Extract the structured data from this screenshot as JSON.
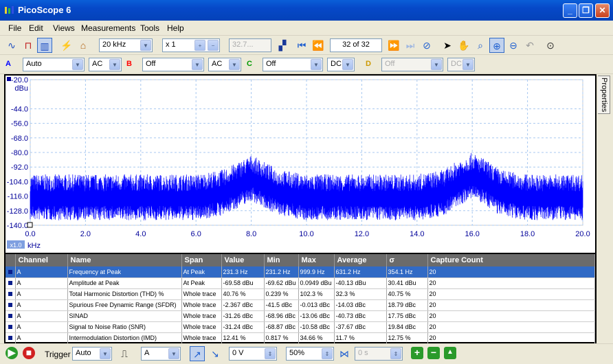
{
  "window": {
    "title": "PicoScope 6"
  },
  "menu": [
    "File",
    "Edit",
    "Views",
    "Measurements",
    "Tools",
    "Help"
  ],
  "toolbar": {
    "timebase": "20 kHz",
    "multiplier": "x 1",
    "disabled_value": "32.7...",
    "capture_counter": "32 of 32"
  },
  "channels": [
    {
      "label": "A",
      "range": "Auto",
      "coupling": "AC",
      "color": "#0000ff"
    },
    {
      "label": "B",
      "range": "Off",
      "coupling": "AC",
      "color": "#ff0000"
    },
    {
      "label": "C",
      "range": "Off",
      "coupling": "DC",
      "color": "#009900"
    },
    {
      "label": "D",
      "range": "Off",
      "coupling": "DC",
      "color": "#cc9900"
    }
  ],
  "plot": {
    "y_unit": "dBu",
    "y_ticks": [
      "-20.0",
      "-44.0",
      "-56.0",
      "-68.0",
      "-80.0",
      "-92.0",
      "-104.0",
      "-116.0",
      "-128.0",
      "-140.0"
    ],
    "x_ticks": [
      "0.0",
      "2.0",
      "4.0",
      "6.0",
      "8.0",
      "10.0",
      "12.0",
      "14.0",
      "16.0",
      "18.0",
      "20.0"
    ],
    "x_unit": "kHz",
    "zoom_label": "x1.0"
  },
  "chart_data": {
    "type": "line",
    "xlabel": "kHz",
    "ylabel": "dBu",
    "xlim": [
      0,
      20
    ],
    "ylim": [
      -140,
      -20
    ],
    "grid": true,
    "series": [
      {
        "color": "#0000ff",
        "x": [
          0,
          1,
          2,
          3,
          4,
          5,
          6,
          7,
          7.5,
          8,
          8.5,
          9,
          10,
          11,
          12,
          13,
          14,
          15,
          15.5,
          16,
          16.5,
          17,
          18,
          19,
          20
        ],
        "y": [
          -116,
          -116,
          -116,
          -116,
          -116,
          -116,
          -116,
          -112,
          -106,
          -100,
          -106,
          -112,
          -116,
          -116,
          -116,
          -116,
          -116,
          -112,
          -104,
          -98,
          -104,
          -112,
          -116,
          -116,
          -116
        ]
      }
    ]
  },
  "measurements": {
    "headers": [
      "Channel",
      "Name",
      "Span",
      "Value",
      "Min",
      "Max",
      "Average",
      "σ",
      "Capture Count"
    ],
    "rows": [
      [
        "A",
        "Frequency at Peak",
        "At Peak",
        "231.3 Hz",
        "231.2 Hz",
        "999.9 Hz",
        "631.2 Hz",
        "354.1 Hz",
        "20"
      ],
      [
        "A",
        "Amplitude at Peak",
        "At Peak",
        "-69.58 dBu",
        "-69.62 dBu",
        "0.0949 dBu",
        "-40.13 dBu",
        "30.41 dBu",
        "20"
      ],
      [
        "A",
        "Total Harmonic Distortion (THD) %",
        "Whole trace",
        "40.76 %",
        "0.239 %",
        "102.3 %",
        "32.3 %",
        "40.75 %",
        "20"
      ],
      [
        "A",
        "Spurious Free Dynamic Range (SFDR)",
        "Whole trace",
        "-2.367 dBc",
        "-41.5 dBc",
        "-0.013 dBc",
        "-14.03 dBc",
        "18.79 dBc",
        "20"
      ],
      [
        "A",
        "SINAD",
        "Whole trace",
        "-31.26 dBc",
        "-68.96 dBc",
        "-13.06 dBc",
        "-40.73 dBc",
        "17.75 dBc",
        "20"
      ],
      [
        "A",
        "Signal to Noise Ratio (SNR)",
        "Whole trace",
        "-31.24 dBc",
        "-68.87 dBc",
        "-10.58 dBc",
        "-37.67 dBc",
        "19.84 dBc",
        "20"
      ],
      [
        "A",
        "Intermodulation Distortion (IMD)",
        "Whole trace",
        "12.41 %",
        "0.817 %",
        "34.66 %",
        "11.7 %",
        "12.75 %",
        "20"
      ]
    ]
  },
  "side_tab": "Properties",
  "status": {
    "trigger_label": "Trigger",
    "trigger_mode": "Auto",
    "trigger_source": "A",
    "threshold": "0 V",
    "pre_trigger": "50%",
    "delay": "0 s"
  }
}
